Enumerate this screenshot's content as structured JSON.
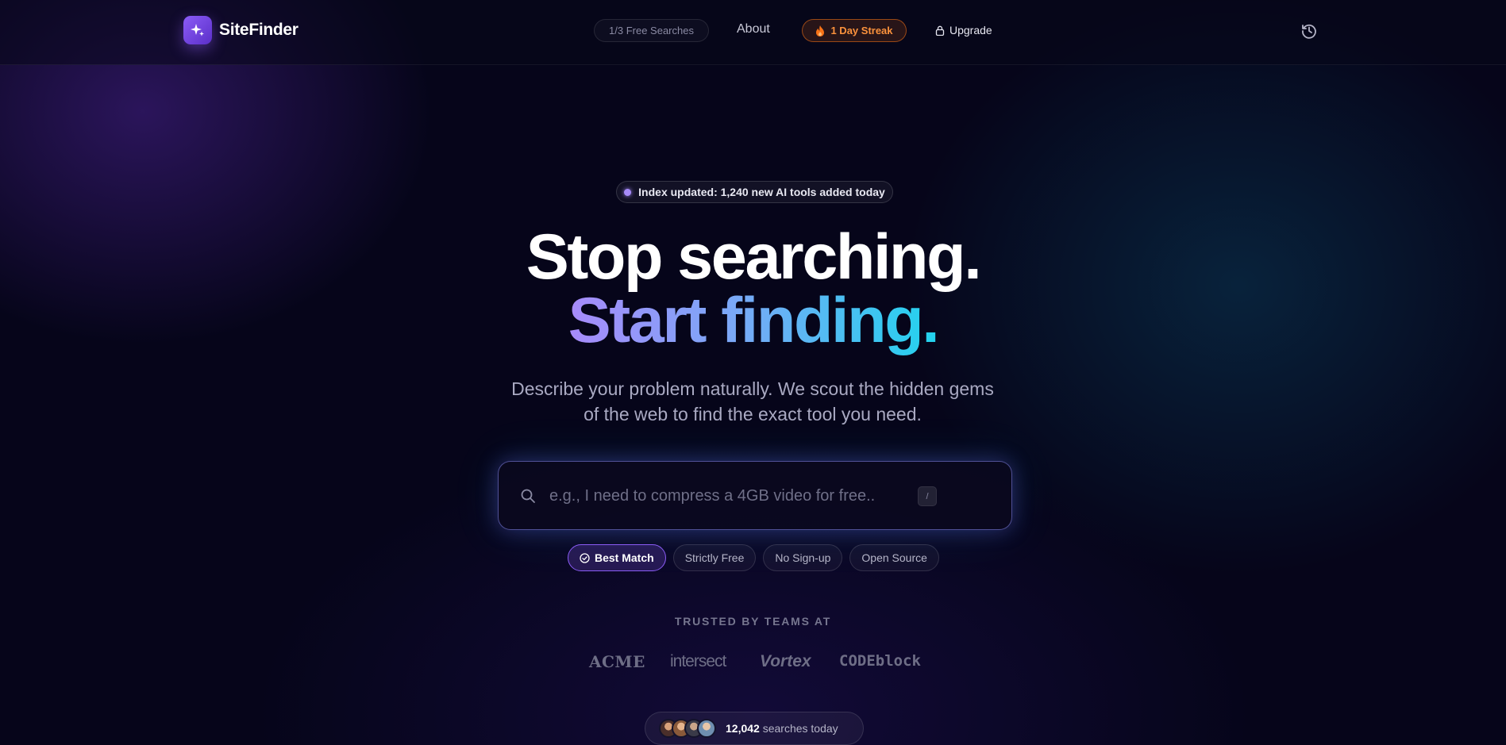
{
  "header": {
    "brand": "SiteFinder",
    "free_searches": "1/3 Free Searches",
    "about": "About",
    "streak": "1 Day Streak",
    "upgrade": "Upgrade",
    "icons": {
      "logo": "sparkle-icon",
      "streak": "flame-icon",
      "upgrade": "lock-icon",
      "history": "history-icon"
    }
  },
  "hero": {
    "badge": "Index updated: 1,240 new AI tools added today",
    "title_line1": "Stop searching.",
    "title_line2": "Start finding.",
    "subtitle_line1": "Describe your problem naturally. We scout the hidden gems",
    "subtitle_line2": "of the web to find the exact tool you need."
  },
  "search": {
    "placeholder": "e.g., I need to compress a 4GB video for free..",
    "value": "",
    "shortcut": "/"
  },
  "filters": [
    {
      "label": "Best Match",
      "active": true
    },
    {
      "label": "Strictly Free",
      "active": false
    },
    {
      "label": "No Sign-up",
      "active": false
    },
    {
      "label": "Open Source",
      "active": false
    }
  ],
  "trusted": {
    "heading": "TRUSTED BY TEAMS AT",
    "brands": [
      "ACME",
      "intersect",
      "Vortex",
      "CODEblock"
    ]
  },
  "social_proof": {
    "count": "12,042",
    "label": "searches today"
  },
  "colors": {
    "accent_purple": "#8b5cf6",
    "accent_cyan": "#22d3ee",
    "streak_orange": "#fb923c",
    "background": "#06051a"
  }
}
